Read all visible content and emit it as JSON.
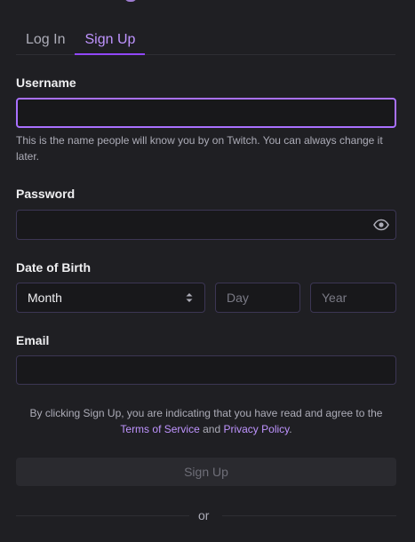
{
  "tabs": [
    {
      "label": "Log In",
      "active": false
    },
    {
      "label": "Sign Up",
      "active": true
    }
  ],
  "username": {
    "label": "Username",
    "value": "",
    "hint": "This is the name people will know you by on Twitch. You can always change it later."
  },
  "password": {
    "label": "Password",
    "value": "",
    "icon": "eye-icon"
  },
  "dob": {
    "label": "Date of Birth",
    "month": "Month",
    "day_placeholder": "Day",
    "year_placeholder": "Year"
  },
  "email": {
    "label": "Email",
    "value": ""
  },
  "terms": {
    "prefix": "By clicking Sign Up, you are indicating that you have read and agree to the",
    "tos_link": "Terms of Service",
    "and": "and",
    "privacy_link": "Privacy Policy",
    "suffix": "."
  },
  "signup_button": "Sign Up",
  "divider_text": "or",
  "colors": {
    "background": "#1f1f23",
    "accent": "#9147ff",
    "accent_text": "#bf94ff",
    "field_bg": "#18181b",
    "field_border": "#3c3654"
  }
}
